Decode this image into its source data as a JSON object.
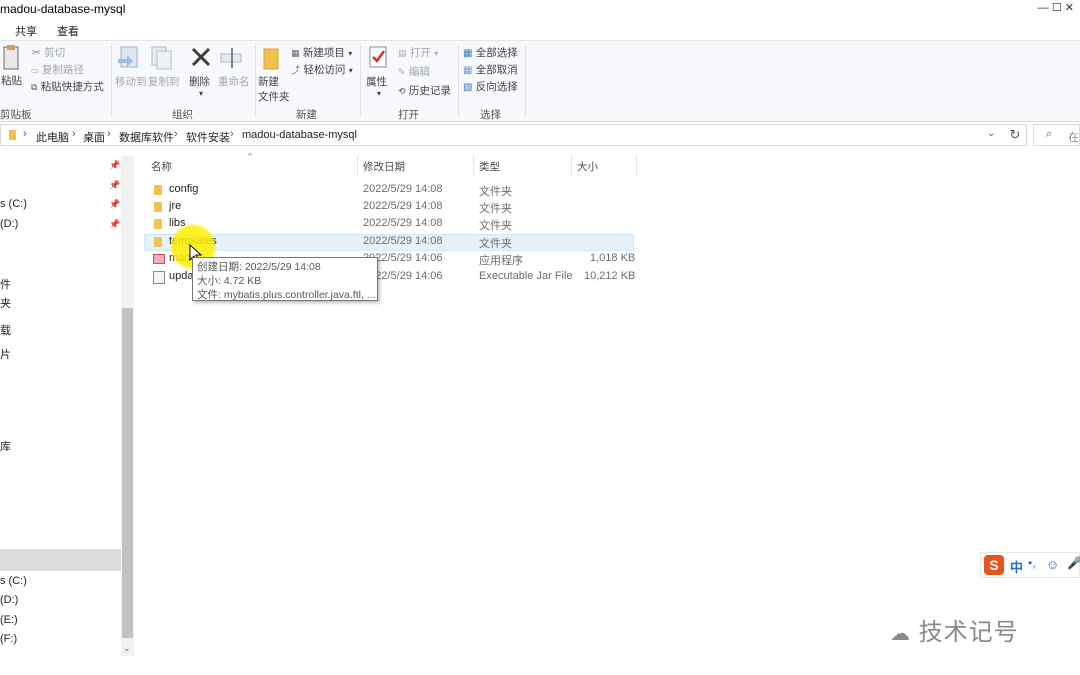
{
  "window": {
    "title": "madou-database-mysql",
    "controls": "— ☐ ✕"
  },
  "tabs": [
    "共享",
    "查看"
  ],
  "ribbon": {
    "clipboard": {
      "paste": "粘贴",
      "cut": "剪切",
      "copy_path": "复制路径",
      "paste_shortcut": "粘贴快捷方式",
      "group": "剪贴板"
    },
    "organize": {
      "move_to": "移动到",
      "copy_to": "复制到",
      "delete": "删除",
      "rename": "重命名",
      "group": "组织"
    },
    "new": {
      "new_folder_line1": "新建",
      "new_folder_line2": "文件夹",
      "new_item": "新建项目",
      "easy_access": "轻松访问",
      "group": "新建"
    },
    "open": {
      "properties": "属性",
      "open": "打开",
      "edit": "编辑",
      "history": "历史记录",
      "group": "打开"
    },
    "select": {
      "select_all": "全部选择",
      "select_none": "全部取消",
      "invert": "反向选择",
      "group": "选择"
    },
    "dropdown_glyph": "▾"
  },
  "address": {
    "crumbs": [
      "此电脑",
      "桌面",
      "数据库软件",
      "软件安装",
      "madou-database-mysql"
    ],
    "search_placeholder": "在"
  },
  "nav": {
    "items": [
      "s (C:)",
      "(D:)",
      "件",
      "夹",
      "载",
      "片",
      "库",
      "s (C:)",
      "(D:)",
      "(E:)",
      "(F:)"
    ]
  },
  "columns": {
    "name": "名称",
    "modified": "修改日期",
    "type": "类型",
    "size": "大小"
  },
  "files": [
    {
      "name": "config",
      "modified": "2022/5/29 14:08",
      "type": "文件夹",
      "size": "",
      "icon": "folder-icon"
    },
    {
      "name": "jre",
      "modified": "2022/5/29 14:08",
      "type": "文件夹",
      "size": "",
      "icon": "folder-icon"
    },
    {
      "name": "libs",
      "modified": "2022/5/29 14:08",
      "type": "文件夹",
      "size": "",
      "icon": "folder-icon"
    },
    {
      "name": "templates",
      "modified": "2022/5/29 14:08",
      "type": "文件夹",
      "size": "",
      "icon": "folder-icon"
    },
    {
      "name": "mad",
      "modified": "2022/5/29 14:06",
      "type": "应用程序",
      "size": "1,018 KB",
      "icon": "exe-icon"
    },
    {
      "name": "upda",
      "modified": "2022/5/29 14:06",
      "type": "Executable Jar File",
      "size": "10,212 KB",
      "icon": "jar-icon"
    }
  ],
  "tooltip": {
    "created": "创建日期: 2022/5/29 14:08",
    "size": "大小: 4.72 KB",
    "files": "文件: mybatis.plus.controller.java.ftl, ..."
  },
  "ime": {
    "lang": "中",
    "punct": "•,",
    "emoji": "☺",
    "mic": "🎤"
  },
  "watermark": "技术记号",
  "colors": {
    "folder": "#f2c14e",
    "hover_row": "#e5f1fb",
    "highlight": "#fff000",
    "ime_logo": "#e8541c"
  }
}
